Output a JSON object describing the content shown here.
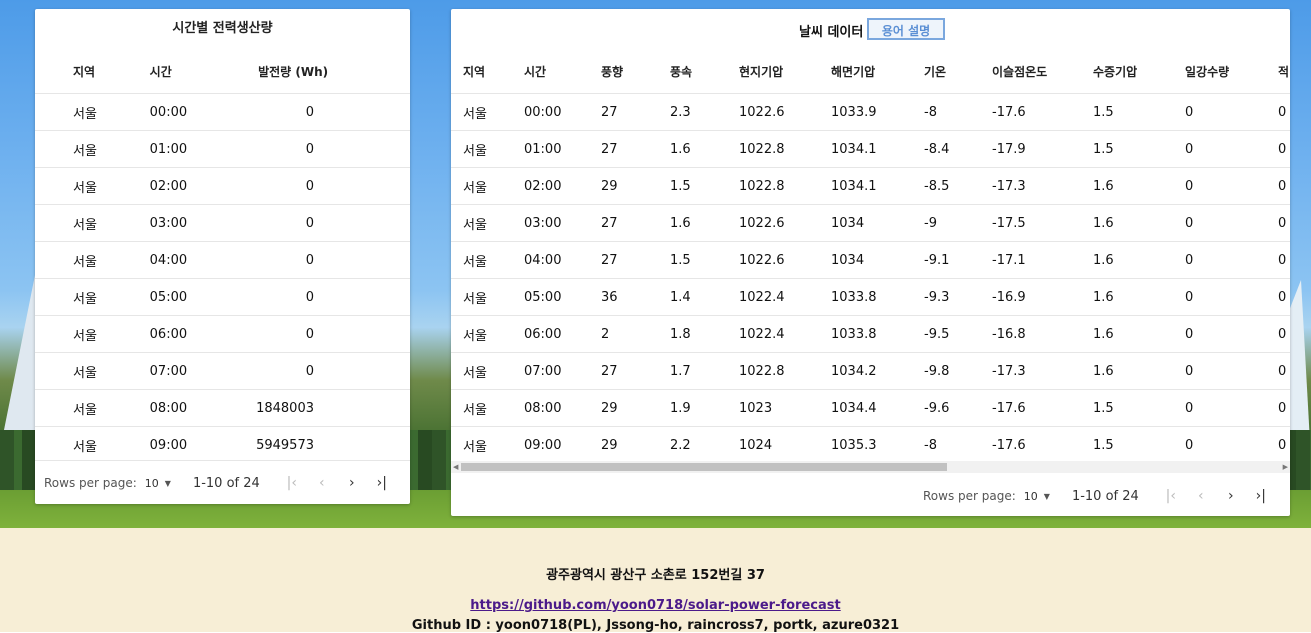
{
  "power": {
    "title": "시간별 전력생산량",
    "headers": [
      "지역",
      "시간",
      "발전량 (Wh)"
    ],
    "rows": [
      [
        "서울",
        "00:00",
        "0"
      ],
      [
        "서울",
        "01:00",
        "0"
      ],
      [
        "서울",
        "02:00",
        "0"
      ],
      [
        "서울",
        "03:00",
        "0"
      ],
      [
        "서울",
        "04:00",
        "0"
      ],
      [
        "서울",
        "05:00",
        "0"
      ],
      [
        "서울",
        "06:00",
        "0"
      ],
      [
        "서울",
        "07:00",
        "0"
      ],
      [
        "서울",
        "08:00",
        "1848003"
      ],
      [
        "서울",
        "09:00",
        "5949573"
      ]
    ],
    "pager": {
      "rows_label": "Rows per page:",
      "rows_value": "10",
      "range": "1-10 of 24"
    }
  },
  "weather": {
    "title": "날씨 데이터",
    "term_button": "용어 설명",
    "headers": [
      "지역",
      "시간",
      "풍향",
      "풍속",
      "현지기압",
      "해면기압",
      "기온",
      "이슬점온도",
      "수증기압",
      "일강수량",
      "적"
    ],
    "rows": [
      [
        "서울",
        "00:00",
        "27",
        "2.3",
        "1022.6",
        "1033.9",
        "-8",
        "-17.6",
        "1.5",
        "0",
        "0"
      ],
      [
        "서울",
        "01:00",
        "27",
        "1.6",
        "1022.8",
        "1034.1",
        "-8.4",
        "-17.9",
        "1.5",
        "0",
        "0"
      ],
      [
        "서울",
        "02:00",
        "29",
        "1.5",
        "1022.8",
        "1034.1",
        "-8.5",
        "-17.3",
        "1.6",
        "0",
        "0"
      ],
      [
        "서울",
        "03:00",
        "27",
        "1.6",
        "1022.6",
        "1034",
        "-9",
        "-17.5",
        "1.6",
        "0",
        "0"
      ],
      [
        "서울",
        "04:00",
        "27",
        "1.5",
        "1022.6",
        "1034",
        "-9.1",
        "-17.1",
        "1.6",
        "0",
        "0"
      ],
      [
        "서울",
        "05:00",
        "36",
        "1.4",
        "1022.4",
        "1033.8",
        "-9.3",
        "-16.9",
        "1.6",
        "0",
        "0"
      ],
      [
        "서울",
        "06:00",
        "2",
        "1.8",
        "1022.4",
        "1033.8",
        "-9.5",
        "-16.8",
        "1.6",
        "0",
        "0"
      ],
      [
        "서울",
        "07:00",
        "27",
        "1.7",
        "1022.8",
        "1034.2",
        "-9.8",
        "-17.3",
        "1.6",
        "0",
        "0"
      ],
      [
        "서울",
        "08:00",
        "29",
        "1.9",
        "1023",
        "1034.4",
        "-9.6",
        "-17.6",
        "1.5",
        "0",
        "0"
      ],
      [
        "서울",
        "09:00",
        "29",
        "2.2",
        "1024",
        "1035.3",
        "-8",
        "-17.6",
        "1.5",
        "0",
        "0"
      ]
    ],
    "pager": {
      "rows_label": "Rows per page:",
      "rows_value": "10",
      "range": "1-10 of 24"
    }
  },
  "footer": {
    "address": "광주광역시 광산구 소촌로 152번길 37",
    "link": "https://github.com/yoon0718/solar-power-forecast",
    "github_ids": "Github ID : yoon0718(PL), Jssong-ho, raincross7, portk, azure0321"
  },
  "icons": {
    "first_page": "first-page-icon",
    "prev_page": "chevron-left-icon",
    "next_page": "chevron-right-icon",
    "last_page": "last-page-icon",
    "dropdown": "caret-down-icon"
  }
}
